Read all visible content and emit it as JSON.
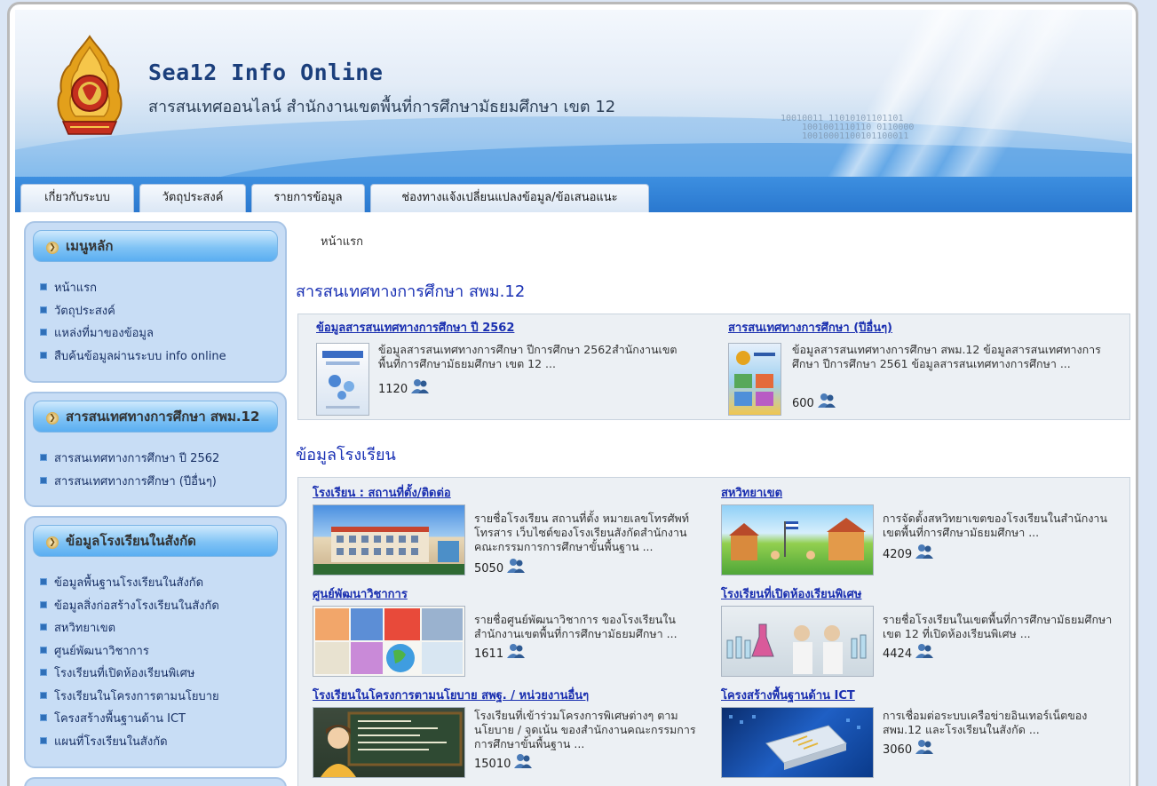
{
  "header": {
    "title": "Sea12 Info Online",
    "subtitle": "สารสนเทศออนไลน์ สำนักงานเขตพื้นที่การศึกษามัธยมศึกษา เขต 12",
    "binary_lines": [
      "10010011 11010101101101",
      "1001001110110 0110000",
      "10010001100101100011"
    ]
  },
  "nav": {
    "tabs": [
      "เกี่ยวกับระบบ",
      "วัตถุประสงค์",
      "รายการข้อมูล",
      "ช่องทางแจ้งเปลี่ยนแปลงข้อมูล/ข้อเสนอแนะ"
    ]
  },
  "sidebar": {
    "main_menu": {
      "title": "เมนูหลัก",
      "items": [
        "หน้าแรก",
        "วัตถุประสงค์",
        "แหล่งที่มาของข้อมูล",
        "สืบค้นข้อมูลผ่านระบบ info online"
      ]
    },
    "edu_info": {
      "title": "สารสนเทศทางการศึกษา สพม.12",
      "items": [
        "สารสนเทศทางการศึกษา ปี 2562",
        "สารสนเทศทางการศึกษา (ปีอื่นๆ)"
      ]
    },
    "school_info": {
      "title": "ข้อมูลโรงเรียนในสังกัด",
      "items": [
        "ข้อมูลพื้นฐานโรงเรียนในสังกัด",
        "ข้อมูลสิ่งก่อสร้างโรงเรียนในสังกัด",
        "สหวิทยาเขต",
        "ศูนย์พัฒนาวิชาการ",
        "โรงเรียนที่เปิดห้องเรียนพิเศษ",
        "โรงเรียนในโครงการตามนโยบาย",
        "โครงสร้างพื้นฐานด้าน ICT",
        "แผนที่โรงเรียนในสังกัด"
      ]
    }
  },
  "main": {
    "breadcrumb": "หน้าแรก",
    "section1": {
      "title": "สารสนเทศทางการศึกษา สพม.12",
      "cards": [
        {
          "title": "ข้อมูลสารสนเทศทางการศึกษา ปี 2562",
          "desc": "ข้อมูลสารสนเทศทางการศึกษา ปีการศึกษา 2562สำนักงานเขตพื้นที่การศึกษามัธยมศึกษา เขต 12 ...",
          "count": "1120"
        },
        {
          "title": "สารสนเทศทางการศึกษา (ปีอื่นๆ)",
          "desc": "ข้อมูลสารสนเทศทางการศึกษา สพม.12 ข้อมูลสารสนเทศทางการศึกษา ปีการศึกษา 2561 ข้อมูลสารสนเทศทางการศึกษา ...",
          "count": "600"
        }
      ]
    },
    "section2": {
      "title": "ข้อมูลโรงเรียน",
      "cards": [
        {
          "title": "โรงเรียน : สถานที่ตั้ง/ติดต่อ",
          "desc": "รายชื่อโรงเรียน สถานที่ตั้ง หมายเลขโทรศัพท์ โทรสาร เว็บไซต์ของโรงเรียนสังกัดสำนักงานคณะกรรมการการศึกษาขั้นพื้นฐาน ...",
          "count": "5050"
        },
        {
          "title": "สหวิทยาเขต",
          "desc": "การจัดตั้งสหวิทยาเขตของโรงเรียนในสำนักงานเขตพื้นที่การศึกษามัธยมศึกษา ...",
          "count": "4209"
        },
        {
          "title": "ศูนย์พัฒนาวิชาการ",
          "desc": "รายชื่อศูนย์พัฒนาวิชาการ ของโรงเรียนในสำนักงานเขตพื้นที่การศึกษามัธยมศึกษา ...",
          "count": "1611"
        },
        {
          "title": "โรงเรียนที่เปิดห้องเรียนพิเศษ",
          "desc": "รายชื่อโรงเรียนในเขตพื้นที่การศึกษามัธยมศึกษา เขต 12 ที่เปิดห้องเรียนพิเศษ ...",
          "count": "4424"
        },
        {
          "title": "โรงเรียนในโครงการตามนโยบาย สพฐ. / หน่วยงานอื่นๆ",
          "desc": "โรงเรียนที่เข้าร่วมโครงการพิเศษต่างๆ ตามนโยบาย / จุดเน้น ของสำนักงานคณะกรรมการการศึกษาขั้นพื้นฐาน ...",
          "count": "15010"
        },
        {
          "title": "โครงสร้างพื้นฐานด้าน ICT",
          "desc": "การเชื่อมต่อระบบเครือข่ายอินเทอร์เน็ตของ สพม.12 และโรงเรียนในสังกัด ...",
          "count": "3060"
        }
      ]
    }
  },
  "colors": {
    "link": "#1a2fb0",
    "section_title": "#1a31b4",
    "nav_bar": "#2a78cf",
    "sidebar_box": "#c8ddf5"
  }
}
